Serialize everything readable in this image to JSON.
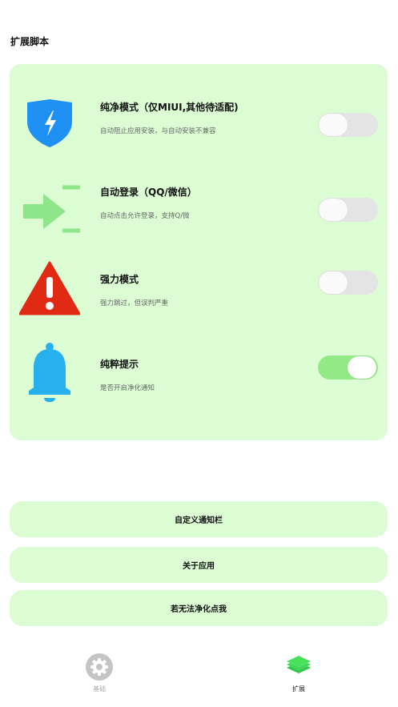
{
  "page": {
    "section_title": "扩展脚本"
  },
  "settings": [
    {
      "title": "纯净模式（仅MIUI,其他待适配)",
      "desc": "自动阻止应用安装，与自动安装不兼容",
      "icon": "shield-bolt-icon",
      "enabled": false
    },
    {
      "title": "自动登录（QQ/微信）",
      "desc": "自动点击允许登录，支持Q/微",
      "icon": "sign-in-icon",
      "enabled": false
    },
    {
      "title": "强力模式",
      "desc": "强力跳过，但误判严重",
      "icon": "warning-icon",
      "enabled": false
    },
    {
      "title": "纯粹提示",
      "desc": "是否开启净化通知",
      "icon": "bell-icon",
      "enabled": true
    }
  ],
  "buttons": {
    "custom_notification": "自定义通知栏",
    "about": "关于应用",
    "help": "若无法净化点我"
  },
  "bottom_nav": {
    "basic": "基础",
    "extend": "扩展"
  },
  "colors": {
    "card_bg": "#dcfdd4",
    "toggle_on": "#93e986",
    "toggle_off": "#e4e4e4",
    "shield_blue": "#1e90f4",
    "arrow_green": "#8fe68a",
    "warning_red": "#e02a14",
    "bell_blue": "#27b0ee",
    "nav_active": "#49e05c",
    "nav_inactive": "#bbbbbb"
  }
}
